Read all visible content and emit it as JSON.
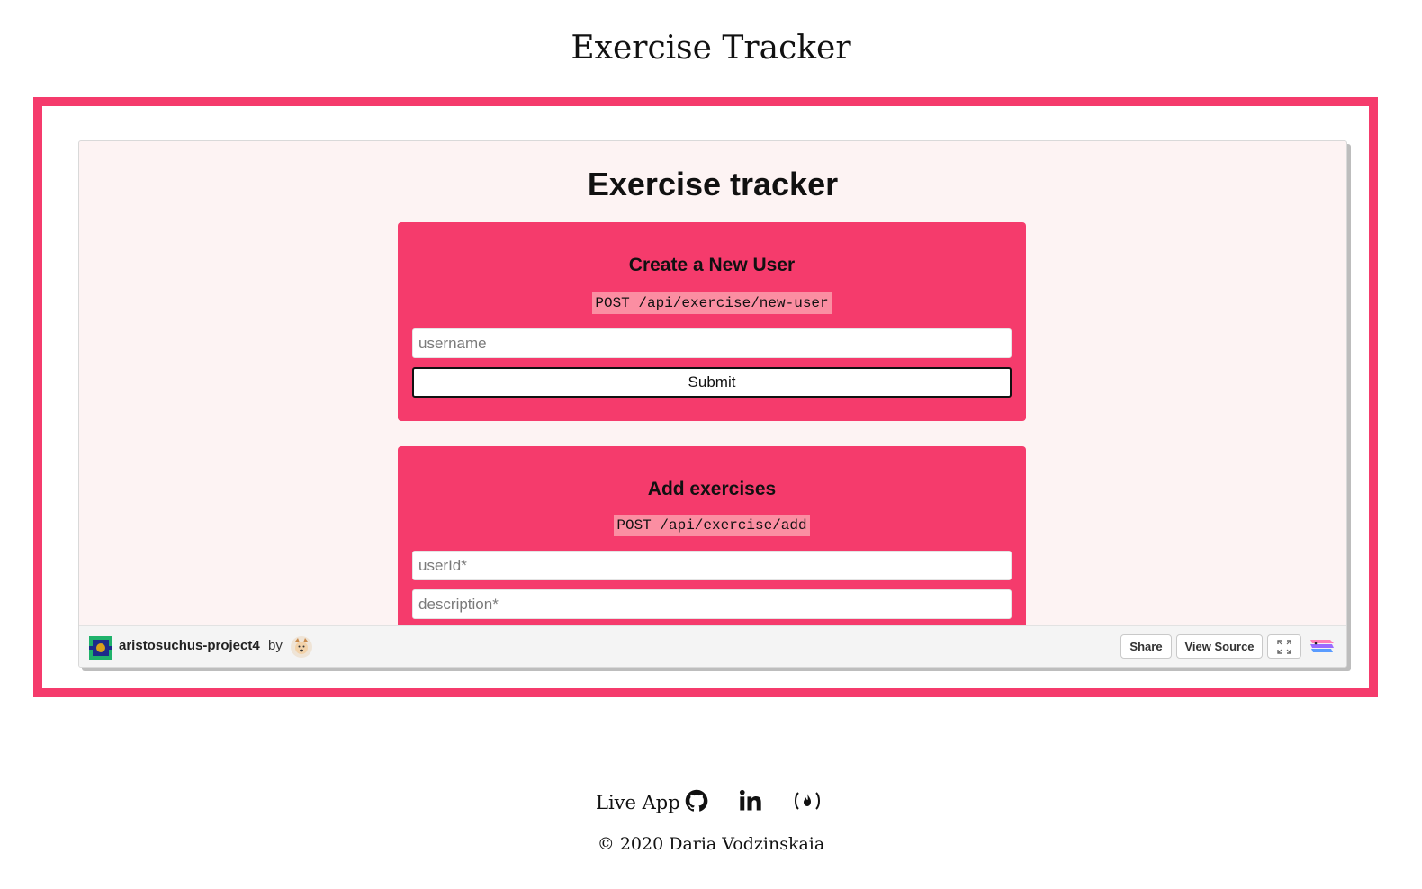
{
  "page": {
    "title": "Exercise Tracker"
  },
  "embed": {
    "app_title": "Exercise tracker",
    "new_user_card": {
      "heading": "Create a New User",
      "endpoint": "POST /api/exercise/new-user",
      "username_placeholder": "username",
      "submit_label": "Submit"
    },
    "exercise_card": {
      "heading": "Add exercises",
      "endpoint": "POST /api/exercise/add",
      "userid_placeholder": "userId*",
      "description_placeholder": "description*"
    },
    "footer": {
      "project_name": "aristosuchus-project4",
      "by_label": "by",
      "share_label": "Share",
      "view_source_label": "View Source",
      "fullscreen_icon": "fullscreen-icon",
      "glitch_icon": "glitch-fish-icon"
    }
  },
  "site_footer": {
    "live_app_label": "Live App",
    "icons": [
      "github-icon",
      "linkedin-icon",
      "freecodecamp-icon"
    ],
    "copyright": "© 2020 Daria Vodzinskaia"
  },
  "colors": {
    "accent": "#f53b6c",
    "endpoint_highlight": "#fb8ea2",
    "embed_background": "#fdf3f3"
  }
}
